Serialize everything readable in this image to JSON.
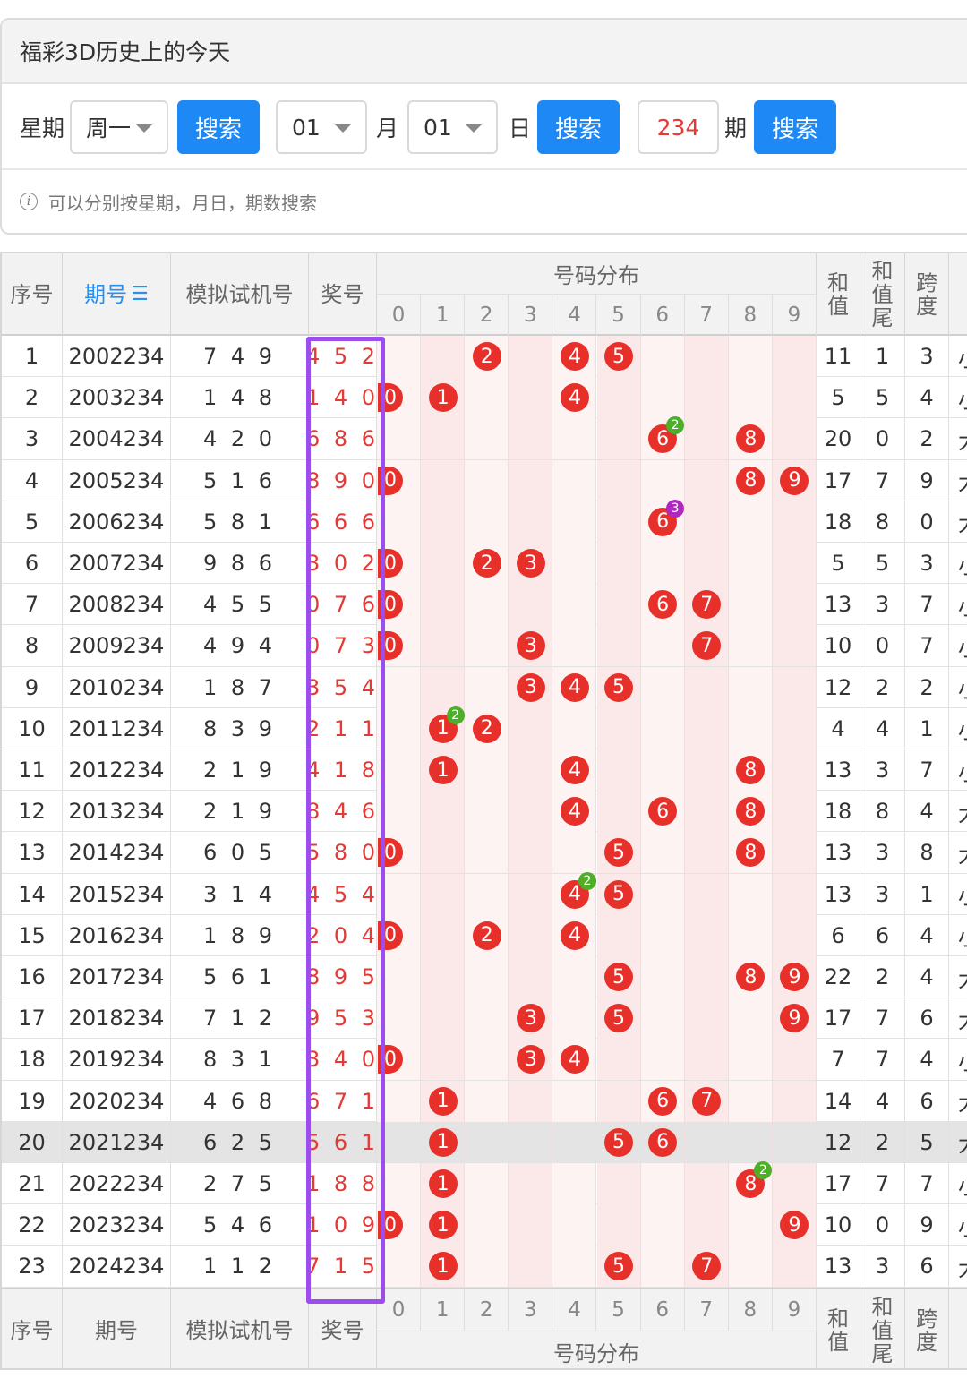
{
  "panel": {
    "title": "福彩3D历史上的今天",
    "weekday_label": "星期",
    "weekday_value": "周一",
    "search_label": "搜索",
    "month_value": "01",
    "month_label": "月",
    "day_value": "01",
    "day_label": "日",
    "issue_value": "234",
    "issue_label": "期",
    "tip_icon": "i",
    "tip": "可以分别按星期，月日，期数搜索"
  },
  "table": {
    "header": {
      "seq": "序号",
      "issue": "期号",
      "sort_icon": "☰",
      "sim": "模拟试机号",
      "win": "奖号",
      "dist": "号码分布",
      "digits": [
        "0",
        "1",
        "2",
        "3",
        "4",
        "5",
        "6",
        "7",
        "8",
        "9"
      ],
      "sum": "和值",
      "sum_tail": "和值尾",
      "span": "跨度"
    },
    "rows": [
      {
        "seq": "1",
        "issue": "2002234",
        "sim": "7 4 9",
        "win": "4 5 2",
        "sum": "11",
        "tail": "1",
        "span": "3",
        "size": "小",
        "balls": [
          2,
          4,
          5
        ],
        "rep": null
      },
      {
        "seq": "2",
        "issue": "2003234",
        "sim": "1 4 8",
        "win": "1 4 0",
        "sum": "5",
        "tail": "5",
        "span": "4",
        "size": "小",
        "balls": [
          0,
          1,
          4
        ],
        "rep": null
      },
      {
        "seq": "3",
        "issue": "2004234",
        "sim": "4 2 0",
        "win": "6 8 6",
        "sum": "20",
        "tail": "0",
        "span": "2",
        "size": "大",
        "balls": [
          6,
          8
        ],
        "rep": {
          "d": 6,
          "n": "2",
          "c": "green"
        }
      },
      {
        "seq": "4",
        "issue": "2005234",
        "sim": "5 1 6",
        "win": "8 9 0",
        "sum": "17",
        "tail": "7",
        "span": "9",
        "size": "大",
        "balls": [
          0,
          8,
          9
        ],
        "rep": null
      },
      {
        "seq": "5",
        "issue": "2006234",
        "sim": "5 8 1",
        "win": "6 6 6",
        "sum": "18",
        "tail": "8",
        "span": "0",
        "size": "大",
        "balls": [
          6
        ],
        "rep": {
          "d": 6,
          "n": "3",
          "c": "purple"
        }
      },
      {
        "seq": "6",
        "issue": "2007234",
        "sim": "9 8 6",
        "win": "3 0 2",
        "sum": "5",
        "tail": "5",
        "span": "3",
        "size": "小",
        "balls": [
          0,
          2,
          3
        ],
        "rep": null
      },
      {
        "seq": "7",
        "issue": "2008234",
        "sim": "4 5 5",
        "win": "0 7 6",
        "sum": "13",
        "tail": "3",
        "span": "7",
        "size": "小",
        "balls": [
          0,
          6,
          7
        ],
        "rep": null
      },
      {
        "seq": "8",
        "issue": "2009234",
        "sim": "4 9 4",
        "win": "0 7 3",
        "sum": "10",
        "tail": "0",
        "span": "7",
        "size": "小",
        "balls": [
          0,
          3,
          7
        ],
        "rep": null
      },
      {
        "seq": "9",
        "issue": "2010234",
        "sim": "1 8 7",
        "win": "3 5 4",
        "sum": "12",
        "tail": "2",
        "span": "2",
        "size": "小",
        "balls": [
          3,
          4,
          5
        ],
        "rep": null
      },
      {
        "seq": "10",
        "issue": "2011234",
        "sim": "8 3 9",
        "win": "2 1 1",
        "sum": "4",
        "tail": "4",
        "span": "1",
        "size": "小",
        "balls": [
          1,
          2
        ],
        "rep": {
          "d": 1,
          "n": "2",
          "c": "green"
        }
      },
      {
        "seq": "11",
        "issue": "2012234",
        "sim": "2 1 9",
        "win": "4 1 8",
        "sum": "13",
        "tail": "3",
        "span": "7",
        "size": "小",
        "balls": [
          1,
          4,
          8
        ],
        "rep": null
      },
      {
        "seq": "12",
        "issue": "2013234",
        "sim": "2 1 9",
        "win": "8 4 6",
        "sum": "18",
        "tail": "8",
        "span": "4",
        "size": "大",
        "balls": [
          4,
          6,
          8
        ],
        "rep": null
      },
      {
        "seq": "13",
        "issue": "2014234",
        "sim": "6 0 5",
        "win": "5 8 0",
        "sum": "13",
        "tail": "3",
        "span": "8",
        "size": "大",
        "balls": [
          0,
          5,
          8
        ],
        "rep": null
      },
      {
        "seq": "14",
        "issue": "2015234",
        "sim": "3 1 4",
        "win": "4 5 4",
        "sum": "13",
        "tail": "3",
        "span": "1",
        "size": "小",
        "balls": [
          4,
          5
        ],
        "rep": {
          "d": 4,
          "n": "2",
          "c": "green"
        }
      },
      {
        "seq": "15",
        "issue": "2016234",
        "sim": "1 8 9",
        "win": "2 0 4",
        "sum": "6",
        "tail": "6",
        "span": "4",
        "size": "小",
        "balls": [
          0,
          2,
          4
        ],
        "rep": null
      },
      {
        "seq": "16",
        "issue": "2017234",
        "sim": "5 6 1",
        "win": "8 9 5",
        "sum": "22",
        "tail": "2",
        "span": "4",
        "size": "大",
        "balls": [
          5,
          8,
          9
        ],
        "rep": null
      },
      {
        "seq": "17",
        "issue": "2018234",
        "sim": "7 1 2",
        "win": "9 5 3",
        "sum": "17",
        "tail": "7",
        "span": "6",
        "size": "大",
        "balls": [
          3,
          5,
          9
        ],
        "rep": null
      },
      {
        "seq": "18",
        "issue": "2019234",
        "sim": "8 3 1",
        "win": "3 4 0",
        "sum": "7",
        "tail": "7",
        "span": "4",
        "size": "小",
        "balls": [
          0,
          3,
          4
        ],
        "rep": null
      },
      {
        "seq": "19",
        "issue": "2020234",
        "sim": "4 6 8",
        "win": "6 7 1",
        "sum": "14",
        "tail": "4",
        "span": "6",
        "size": "大",
        "balls": [
          1,
          6,
          7
        ],
        "rep": null
      },
      {
        "seq": "20",
        "issue": "2021234",
        "sim": "6 2 5",
        "win": "5 6 1",
        "sum": "12",
        "tail": "2",
        "span": "5",
        "size": "大",
        "balls": [
          1,
          5,
          6
        ],
        "rep": null
      },
      {
        "seq": "21",
        "issue": "2022234",
        "sim": "2 7 5",
        "win": "1 8 8",
        "sum": "17",
        "tail": "7",
        "span": "7",
        "size": "小",
        "balls": [
          1,
          8
        ],
        "rep": {
          "d": 8,
          "n": "2",
          "c": "green"
        }
      },
      {
        "seq": "22",
        "issue": "2023234",
        "sim": "5 4 6",
        "win": "1 0 9",
        "sum": "10",
        "tail": "0",
        "span": "9",
        "size": "小",
        "balls": [
          0,
          1,
          9
        ],
        "rep": null
      },
      {
        "seq": "23",
        "issue": "2024234",
        "sim": "1 1 2",
        "win": "7 1 5",
        "sum": "13",
        "tail": "3",
        "span": "6",
        "size": "大",
        "balls": [
          1,
          5,
          7
        ],
        "rep": null
      }
    ],
    "highlight_row": "20",
    "footer": {
      "seq": "序号",
      "issue": "期号",
      "sim": "模拟试机号",
      "win": "奖号",
      "dist": "号码分布",
      "sum": "和值",
      "sum_tail": "和值尾",
      "span": "跨度"
    }
  },
  "colors": {
    "accent": "#1e88f5",
    "ball": "#e8302a",
    "win_text": "#e53935",
    "frame": "#9b4dee",
    "badge_green": "#4caf27",
    "badge_purple": "#b026c0"
  }
}
